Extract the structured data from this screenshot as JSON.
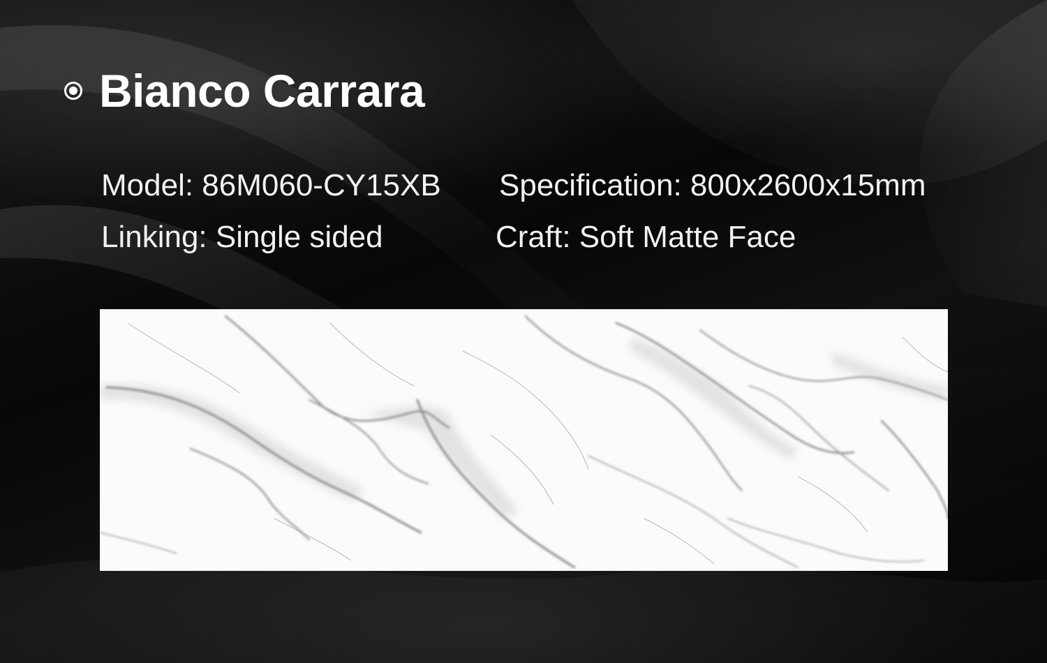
{
  "product": {
    "title": "Bianco Carrara",
    "bullet_icon": "radio-bullet-icon"
  },
  "specs": {
    "model": "Model: 86M060-CY15XB",
    "specification": "Specification: 800x2600x15mm",
    "linking": "Linking: Single sided",
    "craft": "Craft: Soft Matte Face"
  },
  "colors": {
    "background": "#050505",
    "text": "#ffffff",
    "slab": "#fbfbfb",
    "vein": "#8a8a8a"
  },
  "images": {
    "slab": "white marble slab with grey veins",
    "background": "dark black silk fabric"
  }
}
